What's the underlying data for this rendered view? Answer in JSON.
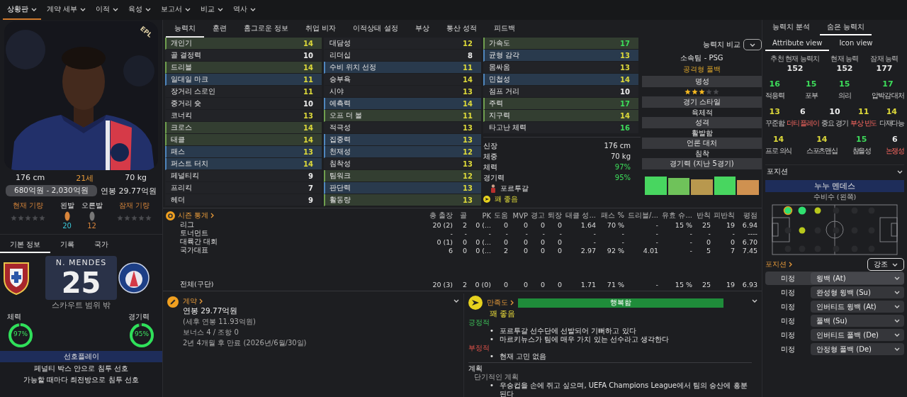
{
  "menu": [
    {
      "label": "상황판",
      "selected": true
    },
    {
      "label": "계약 세부",
      "selected": false
    },
    {
      "label": "이적",
      "selected": false
    },
    {
      "label": "육성",
      "selected": false
    },
    {
      "label": "보고서",
      "selected": false
    },
    {
      "label": "비교",
      "selected": false
    },
    {
      "label": "역사",
      "selected": false
    }
  ],
  "profile": {
    "badge": "EPL",
    "height": "176 cm",
    "age": "21세",
    "weight": "70 kg",
    "value": "680억원 - 2,030억원",
    "wage": "연봉 29.77억원",
    "current_ability": {
      "label": "현재 기량",
      "stars": 0
    },
    "potential_ability": {
      "label": "잠재 기량",
      "stars": 0
    },
    "feet": [
      {
        "label": "왼발",
        "rating": "20",
        "preferred": true
      },
      {
        "label": "오른발",
        "rating": "12",
        "preferred": false
      }
    ]
  },
  "info_tabs": [
    {
      "label": "기본 정보",
      "selected": true
    },
    {
      "label": "기록",
      "selected": false
    },
    {
      "label": "국가",
      "selected": false
    }
  ],
  "shirt": {
    "name": "N. MENDES",
    "number": "25",
    "note": "스카우트 범위 밖"
  },
  "rings": [
    {
      "label": "체력",
      "reading": "97%",
      "level": 0.97
    },
    {
      "label": "경기력",
      "reading": "95%",
      "level": 0.95
    }
  ],
  "preferred_moves": {
    "title": "선호플레이",
    "items": [
      "페널티 박스 안으로 침투 선호",
      "가능할 때마다 최전방으로 침투 선호"
    ]
  },
  "tabs": [
    {
      "label": "능력치",
      "selected": true
    },
    {
      "label": "훈련",
      "selected": false
    },
    {
      "label": "홈그로운 정보",
      "selected": false
    },
    {
      "label": "취업 비자",
      "selected": false
    },
    {
      "label": "이적상태 설정",
      "selected": false
    },
    {
      "label": "부상",
      "selected": false
    },
    {
      "label": "통산 성적",
      "selected": false
    },
    {
      "label": "피드백",
      "selected": false
    }
  ],
  "attributes": [
    {
      "items": [
        {
          "name": "개인기",
          "value": "14",
          "kind": "key"
        },
        {
          "name": "골 결정력",
          "value": "10",
          "kind": "normal"
        },
        {
          "name": "드리블",
          "value": "14",
          "kind": "key"
        },
        {
          "name": "일대일 마크",
          "value": "11",
          "kind": "important"
        },
        {
          "name": "장거리 스로인",
          "value": "11",
          "kind": "normal"
        },
        {
          "name": "중거리 슛",
          "value": "10",
          "kind": "normal"
        },
        {
          "name": "코너킥",
          "value": "13",
          "kind": "normal"
        },
        {
          "name": "크로스",
          "value": "14",
          "kind": "key"
        },
        {
          "name": "태클",
          "value": "14",
          "kind": "key"
        },
        {
          "name": "패스",
          "value": "13",
          "kind": "important"
        },
        {
          "name": "퍼스트 터치",
          "value": "14",
          "kind": "important"
        },
        {
          "name": "페널티킥",
          "value": "9",
          "kind": "normal"
        },
        {
          "name": "프리킥",
          "value": "7",
          "kind": "normal"
        },
        {
          "name": "헤더",
          "value": "9",
          "kind": "normal"
        }
      ]
    },
    {
      "items": [
        {
          "name": "대담성",
          "value": "12",
          "kind": "normal"
        },
        {
          "name": "리더십",
          "value": "8",
          "kind": "normal"
        },
        {
          "name": "수비 위치 선정",
          "value": "11",
          "kind": "important"
        },
        {
          "name": "승부욕",
          "value": "14",
          "kind": "normal"
        },
        {
          "name": "시야",
          "value": "13",
          "kind": "normal"
        },
        {
          "name": "예측력",
          "value": "14",
          "kind": "important"
        },
        {
          "name": "오프 더 볼",
          "value": "11",
          "kind": "key"
        },
        {
          "name": "적극성",
          "value": "13",
          "kind": "normal"
        },
        {
          "name": "집중력",
          "value": "13",
          "kind": "important"
        },
        {
          "name": "천재성",
          "value": "12",
          "kind": "important"
        },
        {
          "name": "침착성",
          "value": "13",
          "kind": "normal"
        },
        {
          "name": "팀워크",
          "value": "12",
          "kind": "key"
        },
        {
          "name": "판단력",
          "value": "13",
          "kind": "important"
        },
        {
          "name": "활동량",
          "value": "13",
          "kind": "key"
        }
      ]
    },
    {
      "items": [
        {
          "name": "가속도",
          "value": "17",
          "kind": "key"
        },
        {
          "name": "균형 감각",
          "value": "13",
          "kind": "important"
        },
        {
          "name": "몸싸움",
          "value": "13",
          "kind": "normal"
        },
        {
          "name": "민첩성",
          "value": "14",
          "kind": "important"
        },
        {
          "name": "점프 거리",
          "value": "10",
          "kind": "normal"
        },
        {
          "name": "주력",
          "value": "17",
          "kind": "key"
        },
        {
          "name": "지구력",
          "value": "14",
          "kind": "key"
        },
        {
          "name": "타고난 체력",
          "value": "16",
          "kind": "normal"
        }
      ]
    }
  ],
  "details": [
    {
      "kind": "stat",
      "label": "신장",
      "value": "176 cm",
      "good": false
    },
    {
      "kind": "stat",
      "label": "체중",
      "value": "70 kg",
      "good": false
    },
    {
      "kind": "stat",
      "label": "체력",
      "value": "97%",
      "good": true
    },
    {
      "kind": "stat",
      "label": "경기력",
      "value": "95%",
      "good": true
    },
    {
      "kind": "nation",
      "label": "포르투갈"
    },
    {
      "kind": "mood",
      "label": "꽤 좋음"
    }
  ],
  "overview": {
    "compare": "능력치 비교",
    "club": "소속팀 - PSG",
    "role": "공격형 풀백",
    "sections": [
      {
        "title": "명성",
        "kind": "stars",
        "stars": 3
      },
      {
        "title": "경기 스타일",
        "kind": "text",
        "value": "육체적"
      },
      {
        "title": "성격",
        "kind": "text",
        "value": "활발함"
      },
      {
        "title": "언론 대처",
        "kind": "text",
        "value": "침착"
      },
      {
        "title": "경기력 (지난 5경기)",
        "kind": "form"
      }
    ],
    "form": [
      {
        "kind": "excellent"
      },
      {
        "kind": "good"
      },
      {
        "kind": "fair"
      },
      {
        "kind": "excellent"
      },
      {
        "kind": "poor"
      }
    ]
  },
  "season_stats": {
    "title": "시즌 통계",
    "columns": [
      "총 출장",
      "골",
      "PK",
      "도움",
      "MVP",
      "경고",
      "퇴장",
      "태클 성...",
      "패스 %",
      "드리블/...",
      "유효 슈...",
      "반칙",
      "피반칙",
      "평점"
    ],
    "rows": [
      {
        "kind": "row",
        "label": "리그",
        "cells": [
          "20 (2)",
          "2",
          "0 (...",
          "0",
          "0",
          "0",
          "0",
          "1.64",
          "70 %",
          "-",
          "15 %",
          "25",
          "19",
          "6.94"
        ]
      },
      {
        "kind": "row",
        "label": "토너먼트",
        "cells": [
          "-",
          "-",
          "-",
          "-",
          "-",
          "-",
          "-",
          "-",
          "-",
          "-",
          "-",
          "-",
          "-",
          "----"
        ]
      },
      {
        "kind": "row",
        "label": "대륙간 대회",
        "cells": [
          "0 (1)",
          "0",
          "0 (...",
          "0",
          "0",
          "0",
          "0",
          "-",
          "-",
          "-",
          "-",
          "0",
          "0",
          "6.70"
        ]
      },
      {
        "kind": "row",
        "label": "국가대표",
        "cells": [
          "6",
          "0",
          "0 (...",
          "2",
          "0",
          "0",
          "0",
          "2.97",
          "92 %",
          "4.01",
          "-",
          "5",
          "7",
          "7.45"
        ]
      },
      {
        "kind": "total",
        "label": "전체(구단)",
        "cells": [
          "20 (3)",
          "2",
          "0 (0)",
          "0",
          "0",
          "0",
          "0",
          "1.71",
          "71 %",
          "-",
          "15 %",
          "25",
          "19",
          "6.93"
        ]
      }
    ]
  },
  "contract": {
    "title": "계약",
    "lines": [
      {
        "kind": "main",
        "text": "연봉 29.77억원"
      },
      {
        "kind": "sub",
        "text": "(세후 연봉 11.93억원)"
      },
      {
        "kind": "sub",
        "text": "보너스 4 / 조항 0"
      },
      {
        "kind": "sub",
        "text": "2년 4개월 후 만료 (2026년/6월/30일)"
      }
    ]
  },
  "happiness": {
    "title": "만족도",
    "bullet": "•",
    "bar": {
      "label": "행복함",
      "level": 1
    },
    "mood": "꽤 좋음",
    "groups": [
      {
        "kind": "positive",
        "title": "긍정적",
        "items": [
          "포르투갈 선수단에 선발되어 기뻐하고 있다",
          "마르키뉴스가 팀에 매우 가치 있는 선수라고 생각한다"
        ]
      },
      {
        "kind": "negative",
        "title": "부정적",
        "items": [
          "현재 고민 없음"
        ]
      }
    ],
    "plans": {
      "title": "계획",
      "subtitle": "단기적인 계획",
      "items": [
        "우승컵을 손에 쥐고 싶으며, UEFA Champions League에서 팀의 승산에 흥분된다"
      ]
    }
  },
  "analysis_tabs": [
    {
      "label": "능력치 분석",
      "selected": false
    },
    {
      "label": "숨은 능력치",
      "selected": true
    }
  ],
  "view_tabs": [
    {
      "label": "Attribute view",
      "selected": true
    },
    {
      "label": "Icon view",
      "selected": false
    }
  ],
  "abilities": [
    {
      "label": "추천 현재 능력치",
      "value": "152"
    },
    {
      "label": "현재 능력",
      "value": "152"
    },
    {
      "label": "잠재 능력",
      "value": "177"
    }
  ],
  "hidden_attributes": [
    [
      {
        "label": "적응력",
        "value": "16",
        "negative": false
      },
      {
        "label": "포부",
        "value": "15",
        "negative": false
      },
      {
        "label": "의리",
        "value": "15",
        "negative": false
      },
      {
        "label": "압박감 대처",
        "value": "17",
        "negative": false
      }
    ],
    [
      {
        "label": "꾸준함",
        "value": "13",
        "negative": false
      },
      {
        "label": "더티 플레이",
        "value": "6",
        "negative": true
      },
      {
        "label": "중요 경기",
        "value": "10",
        "negative": false
      },
      {
        "label": "부상 빈도",
        "value": "11",
        "negative": true
      },
      {
        "label": "다재다능",
        "value": "14",
        "negative": false
      }
    ],
    [
      {
        "label": "프로 의식",
        "value": "14",
        "negative": false
      },
      {
        "label": "스포츠맨십",
        "value": "14",
        "negative": false
      },
      {
        "label": "참을성",
        "value": "15",
        "negative": false
      },
      {
        "label": "논쟁성",
        "value": "6",
        "negative": true
      }
    ]
  ],
  "position": {
    "title": "포지션",
    "name": "누누 멘데스",
    "role": "수비수 (왼쪽)",
    "pitch": [
      [
        {
          "kind": "natural",
          "selected": true
        },
        {
          "kind": "natural",
          "selected": false
        },
        {
          "kind": "accomplished",
          "selected": false
        },
        {
          "kind": "none",
          "selected": false
        },
        {
          "kind": "none",
          "selected": false
        },
        {
          "kind": "none",
          "selected": false
        }
      ],
      [
        {
          "kind": "none",
          "selected": false
        },
        {
          "kind": "accomplished",
          "selected": false
        },
        {
          "kind": "none",
          "selected": false
        },
        {
          "kind": "none",
          "selected": false
        },
        {
          "kind": "none",
          "selected": false
        },
        {
          "kind": "none",
          "selected": false
        }
      ],
      [
        {
          "kind": "none",
          "selected": false
        },
        {
          "kind": "none",
          "selected": false
        },
        {
          "kind": "none",
          "selected": false
        },
        {
          "kind": "none",
          "selected": false
        },
        {
          "kind": "none",
          "selected": false
        },
        {
          "kind": "none",
          "selected": false
        }
      ]
    ],
    "roles_title": "포지션",
    "highlight": "강조",
    "roles": [
      {
        "status": "미정",
        "role": "윙백 (At)",
        "selected": true
      },
      {
        "status": "미정",
        "role": "완성형 윙백 (Su)",
        "selected": false
      },
      {
        "status": "미정",
        "role": "인버티드 윙백 (At)",
        "selected": false
      },
      {
        "status": "미정",
        "role": "풀백 (Su)",
        "selected": false
      },
      {
        "status": "미정",
        "role": "인버티드 풀백 (De)",
        "selected": false
      },
      {
        "status": "미정",
        "role": "안정형 풀백 (De)",
        "selected": false
      }
    ]
  }
}
